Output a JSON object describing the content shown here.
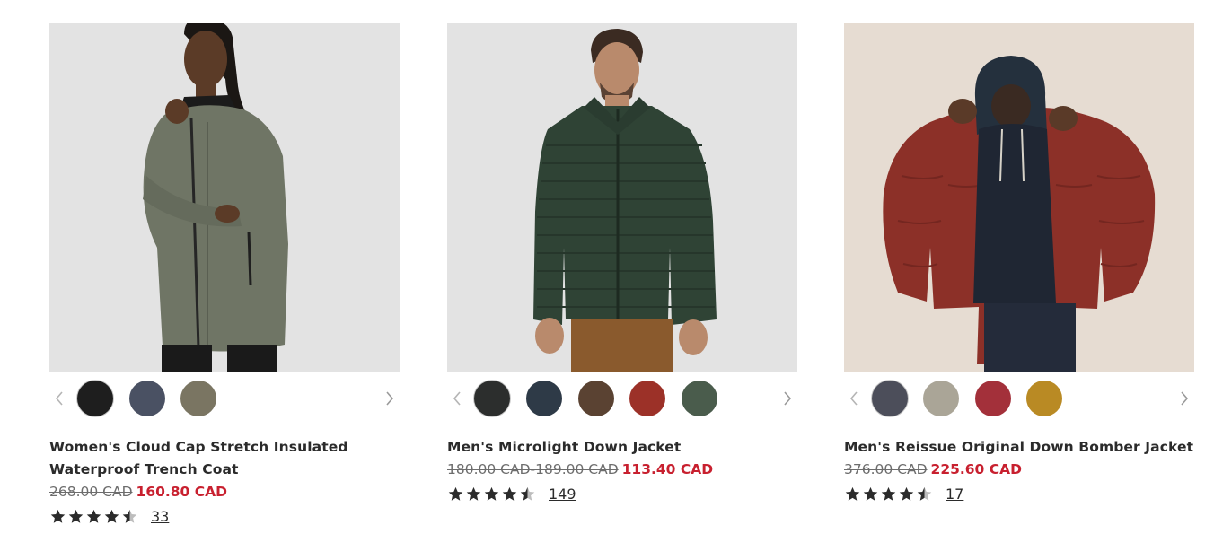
{
  "products": [
    {
      "name": "Women's Cloud Cap Stretch Insulated Waterproof Trench Coat",
      "price_was": "268.00 CAD",
      "price_now": "160.80 CAD",
      "rating": 4.5,
      "review_count": "33",
      "photo_icon": "woman-green-trench-coat",
      "swatches": [
        "#1e1e1e",
        "#4a5163",
        "#7a7562"
      ]
    },
    {
      "name": "Men's Microlight Down Jacket",
      "price_was": "180.00 CAD-189.00 CAD",
      "price_now": "113.40 CAD",
      "rating": 4.5,
      "review_count": "149",
      "photo_icon": "man-green-down-jacket",
      "swatches": [
        "#2c2e2d",
        "#2e3a47",
        "#5a4232",
        "#9c3128",
        "#4a5c4c"
      ]
    },
    {
      "name": "Men's Reissue Original Down Bomber Jacket",
      "price_was": "376.00 CAD",
      "price_now": "225.60 CAD",
      "rating": 4.5,
      "review_count": "17",
      "photo_icon": "man-red-bomber-jacket",
      "swatches": [
        "#4c4e5a",
        "#aaa597",
        "#a3303a",
        "#b98a24"
      ]
    }
  ],
  "colors": {
    "sale_price": "#c8202f",
    "text": "#2b2b2b",
    "was_price": "#6d6d6d"
  }
}
